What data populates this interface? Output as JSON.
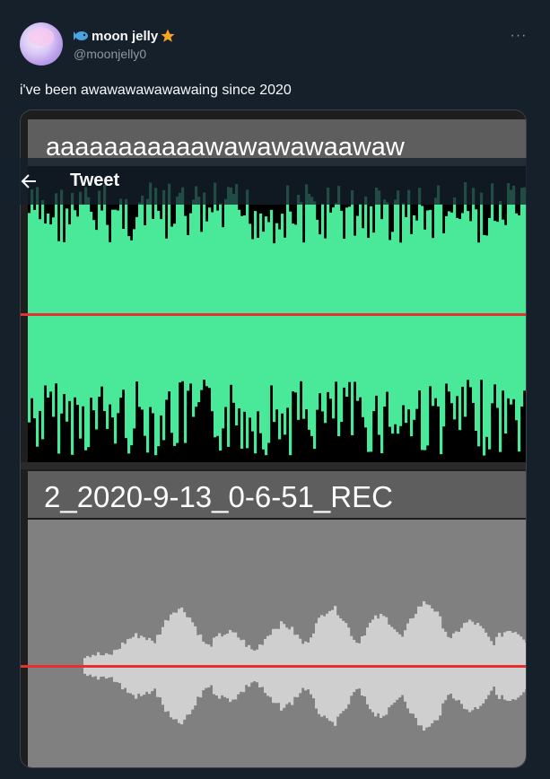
{
  "post": {
    "display_name": "moon jelly",
    "handle": "@moonjelly0",
    "text": "i've been awawawawawawaing since 2020",
    "more": "···"
  },
  "nav": {
    "title": "Tweet"
  },
  "media": {
    "track_top_label": "aaaaaaaaaaawawawawaawaw",
    "track_bottom_label": "2_2020-9-13_0-6-51_REC"
  },
  "colors": {
    "background": "#15202b",
    "waveform_green": "#4ae899",
    "waveform_gray": "#cfcfcf",
    "playhead_red": "#e53030",
    "track_bg_gray": "#808080"
  },
  "icons": {
    "back": "arrow-left-icon",
    "fish": "fish-icon",
    "star": "star-icon",
    "more": "more-icon"
  }
}
